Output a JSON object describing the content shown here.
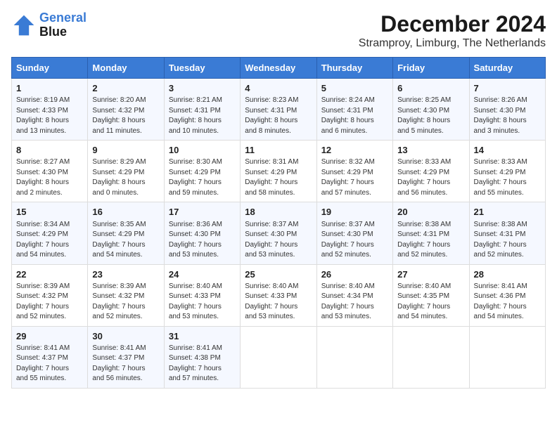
{
  "header": {
    "logo_line1": "General",
    "logo_line2": "Blue",
    "month_title": "December 2024",
    "location": "Stramproy, Limburg, The Netherlands"
  },
  "weekdays": [
    "Sunday",
    "Monday",
    "Tuesday",
    "Wednesday",
    "Thursday",
    "Friday",
    "Saturday"
  ],
  "weeks": [
    [
      {
        "day": "1",
        "info": "Sunrise: 8:19 AM\nSunset: 4:33 PM\nDaylight: 8 hours\nand 13 minutes."
      },
      {
        "day": "2",
        "info": "Sunrise: 8:20 AM\nSunset: 4:32 PM\nDaylight: 8 hours\nand 11 minutes."
      },
      {
        "day": "3",
        "info": "Sunrise: 8:21 AM\nSunset: 4:31 PM\nDaylight: 8 hours\nand 10 minutes."
      },
      {
        "day": "4",
        "info": "Sunrise: 8:23 AM\nSunset: 4:31 PM\nDaylight: 8 hours\nand 8 minutes."
      },
      {
        "day": "5",
        "info": "Sunrise: 8:24 AM\nSunset: 4:31 PM\nDaylight: 8 hours\nand 6 minutes."
      },
      {
        "day": "6",
        "info": "Sunrise: 8:25 AM\nSunset: 4:30 PM\nDaylight: 8 hours\nand 5 minutes."
      },
      {
        "day": "7",
        "info": "Sunrise: 8:26 AM\nSunset: 4:30 PM\nDaylight: 8 hours\nand 3 minutes."
      }
    ],
    [
      {
        "day": "8",
        "info": "Sunrise: 8:27 AM\nSunset: 4:30 PM\nDaylight: 8 hours\nand 2 minutes."
      },
      {
        "day": "9",
        "info": "Sunrise: 8:29 AM\nSunset: 4:29 PM\nDaylight: 8 hours\nand 0 minutes."
      },
      {
        "day": "10",
        "info": "Sunrise: 8:30 AM\nSunset: 4:29 PM\nDaylight: 7 hours\nand 59 minutes."
      },
      {
        "day": "11",
        "info": "Sunrise: 8:31 AM\nSunset: 4:29 PM\nDaylight: 7 hours\nand 58 minutes."
      },
      {
        "day": "12",
        "info": "Sunrise: 8:32 AM\nSunset: 4:29 PM\nDaylight: 7 hours\nand 57 minutes."
      },
      {
        "day": "13",
        "info": "Sunrise: 8:33 AM\nSunset: 4:29 PM\nDaylight: 7 hours\nand 56 minutes."
      },
      {
        "day": "14",
        "info": "Sunrise: 8:33 AM\nSunset: 4:29 PM\nDaylight: 7 hours\nand 55 minutes."
      }
    ],
    [
      {
        "day": "15",
        "info": "Sunrise: 8:34 AM\nSunset: 4:29 PM\nDaylight: 7 hours\nand 54 minutes."
      },
      {
        "day": "16",
        "info": "Sunrise: 8:35 AM\nSunset: 4:29 PM\nDaylight: 7 hours\nand 54 minutes."
      },
      {
        "day": "17",
        "info": "Sunrise: 8:36 AM\nSunset: 4:30 PM\nDaylight: 7 hours\nand 53 minutes."
      },
      {
        "day": "18",
        "info": "Sunrise: 8:37 AM\nSunset: 4:30 PM\nDaylight: 7 hours\nand 53 minutes."
      },
      {
        "day": "19",
        "info": "Sunrise: 8:37 AM\nSunset: 4:30 PM\nDaylight: 7 hours\nand 52 minutes."
      },
      {
        "day": "20",
        "info": "Sunrise: 8:38 AM\nSunset: 4:31 PM\nDaylight: 7 hours\nand 52 minutes."
      },
      {
        "day": "21",
        "info": "Sunrise: 8:38 AM\nSunset: 4:31 PM\nDaylight: 7 hours\nand 52 minutes."
      }
    ],
    [
      {
        "day": "22",
        "info": "Sunrise: 8:39 AM\nSunset: 4:32 PM\nDaylight: 7 hours\nand 52 minutes."
      },
      {
        "day": "23",
        "info": "Sunrise: 8:39 AM\nSunset: 4:32 PM\nDaylight: 7 hours\nand 52 minutes."
      },
      {
        "day": "24",
        "info": "Sunrise: 8:40 AM\nSunset: 4:33 PM\nDaylight: 7 hours\nand 53 minutes."
      },
      {
        "day": "25",
        "info": "Sunrise: 8:40 AM\nSunset: 4:33 PM\nDaylight: 7 hours\nand 53 minutes."
      },
      {
        "day": "26",
        "info": "Sunrise: 8:40 AM\nSunset: 4:34 PM\nDaylight: 7 hours\nand 53 minutes."
      },
      {
        "day": "27",
        "info": "Sunrise: 8:40 AM\nSunset: 4:35 PM\nDaylight: 7 hours\nand 54 minutes."
      },
      {
        "day": "28",
        "info": "Sunrise: 8:41 AM\nSunset: 4:36 PM\nDaylight: 7 hours\nand 54 minutes."
      }
    ],
    [
      {
        "day": "29",
        "info": "Sunrise: 8:41 AM\nSunset: 4:37 PM\nDaylight: 7 hours\nand 55 minutes."
      },
      {
        "day": "30",
        "info": "Sunrise: 8:41 AM\nSunset: 4:37 PM\nDaylight: 7 hours\nand 56 minutes."
      },
      {
        "day": "31",
        "info": "Sunrise: 8:41 AM\nSunset: 4:38 PM\nDaylight: 7 hours\nand 57 minutes."
      },
      null,
      null,
      null,
      null
    ]
  ]
}
